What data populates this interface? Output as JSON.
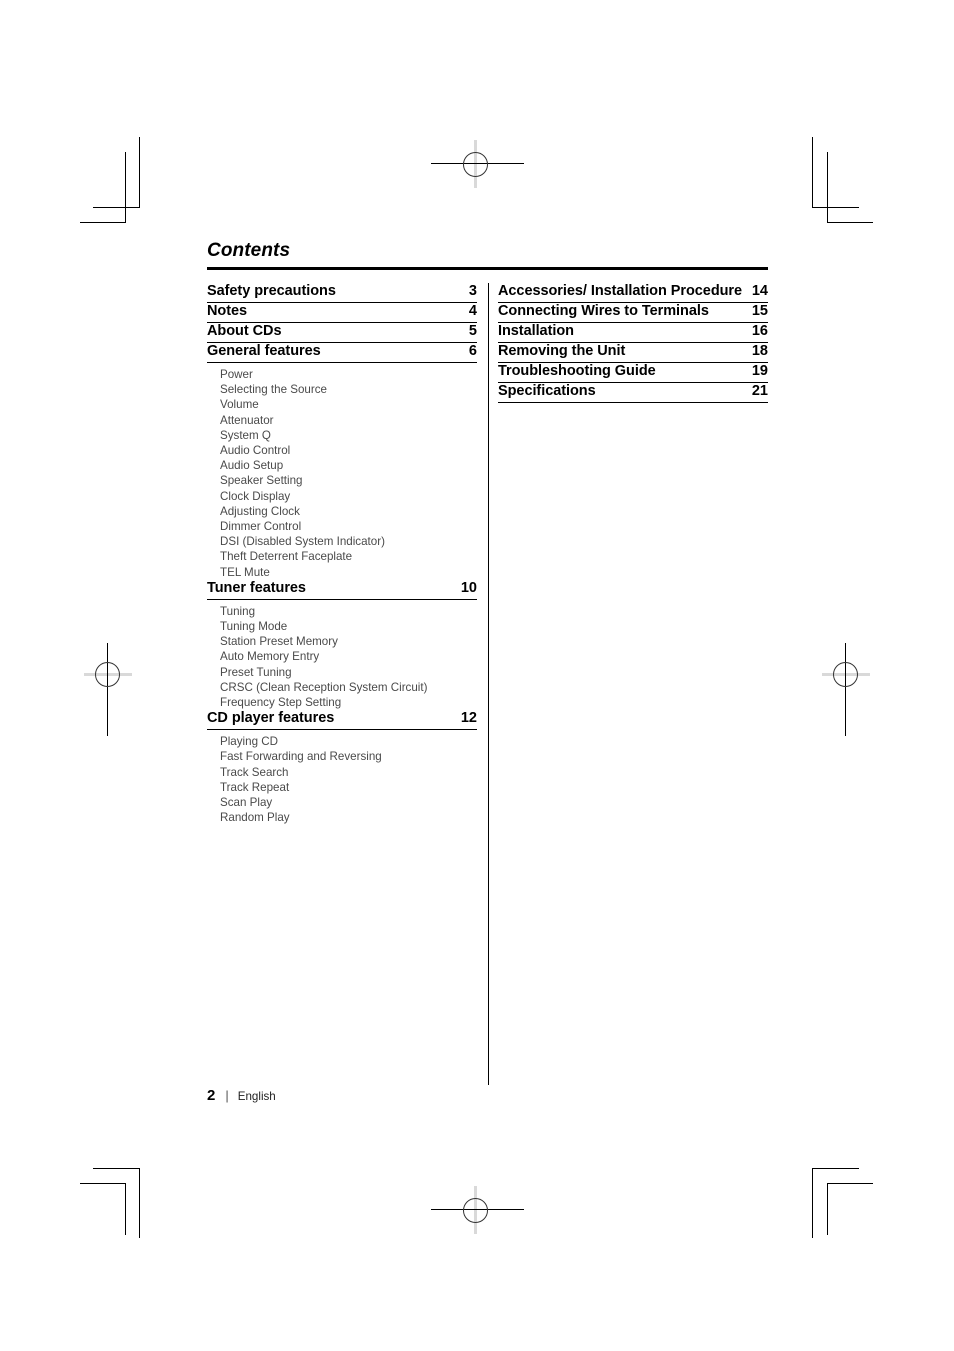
{
  "document": {
    "heading": "Contents",
    "footer": {
      "page_number": "2",
      "separator": "|",
      "language": "English"
    }
  },
  "left_column": [
    {
      "title": "Safety precautions",
      "page": "3",
      "subs": []
    },
    {
      "title": "Notes",
      "page": "4",
      "subs": []
    },
    {
      "title": "About CDs",
      "page": "5",
      "subs": []
    },
    {
      "title": "General features",
      "page": "6",
      "subs": [
        "Power",
        "Selecting the Source",
        "Volume",
        "Attenuator",
        "System Q",
        "Audio Control",
        "Audio Setup",
        "Speaker Setting",
        "Clock Display",
        "Adjusting Clock",
        "Dimmer Control",
        "DSI (Disabled System Indicator)",
        "Theft Deterrent Faceplate",
        "TEL Mute"
      ]
    },
    {
      "title": "Tuner features",
      "page": "10",
      "subs": [
        "Tuning",
        "Tuning Mode",
        "Station Preset Memory",
        "Auto Memory Entry",
        "Preset Tuning",
        "CRSC (Clean Reception System Circuit)",
        "Frequency Step Setting"
      ]
    },
    {
      "title": "CD player features",
      "page": "12",
      "subs": [
        "Playing CD",
        "Fast Forwarding and Reversing",
        "Track Search",
        "Track Repeat",
        "Scan Play",
        "Random Play"
      ]
    }
  ],
  "right_column": [
    {
      "title": "Accessories/ Installation Procedure",
      "page": "14",
      "tight": true,
      "subs": []
    },
    {
      "title": "Connecting Wires to Terminals",
      "page": "15",
      "subs": []
    },
    {
      "title": "Installation",
      "page": "16",
      "subs": []
    },
    {
      "title": "Removing the Unit",
      "page": "18",
      "subs": []
    },
    {
      "title": "Troubleshooting Guide",
      "page": "19",
      "subs": []
    },
    {
      "title": "Specifications",
      "page": "21",
      "subs": []
    }
  ]
}
